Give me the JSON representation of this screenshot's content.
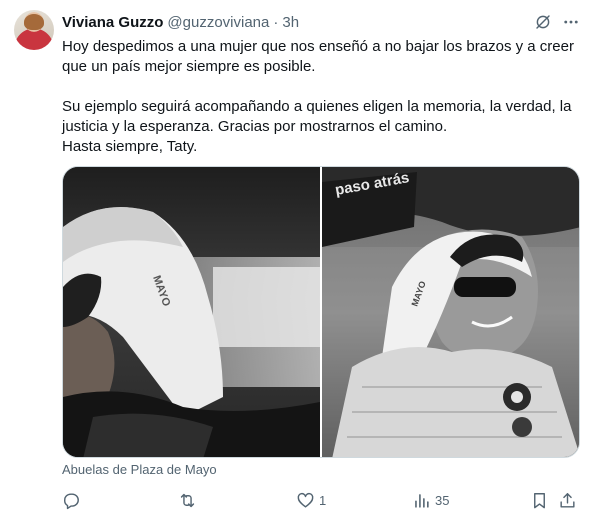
{
  "author": {
    "name": "Viviana Guzzo",
    "handle": "@guzzoviviana",
    "separator": "·",
    "time": "3h"
  },
  "tweet": {
    "lines": [
      "Hoy despedimos a una mujer que nos enseñó a no bajar los brazos y a creer que un país mejor siempre es posible.",
      "Su ejemplo seguirá acompañando a quienes eligen la memoria, la verdad, la justicia y la esperanza. Gracias por mostrarnos el camino.",
      "Hasta siempre, Taty."
    ]
  },
  "media": {
    "left_photo": {
      "banner_text": "MAYO"
    },
    "right_photo": {
      "flag_text": "paso atrás",
      "scarf_text": "MAYO"
    },
    "caption": "Abuelas de Plaza de Mayo"
  },
  "actions": {
    "reply_count": "",
    "retweet_count": "",
    "like_count": "1",
    "views_count": "35"
  },
  "icons": {
    "header": [
      "grok-icon",
      "more-icon"
    ],
    "actions": [
      "reply-icon",
      "retweet-icon",
      "like-icon",
      "views-icon",
      "bookmark-icon",
      "share-icon"
    ]
  },
  "colors": {
    "text_primary": "#0f1419",
    "text_secondary": "#536471",
    "border": "#cfd9de"
  }
}
